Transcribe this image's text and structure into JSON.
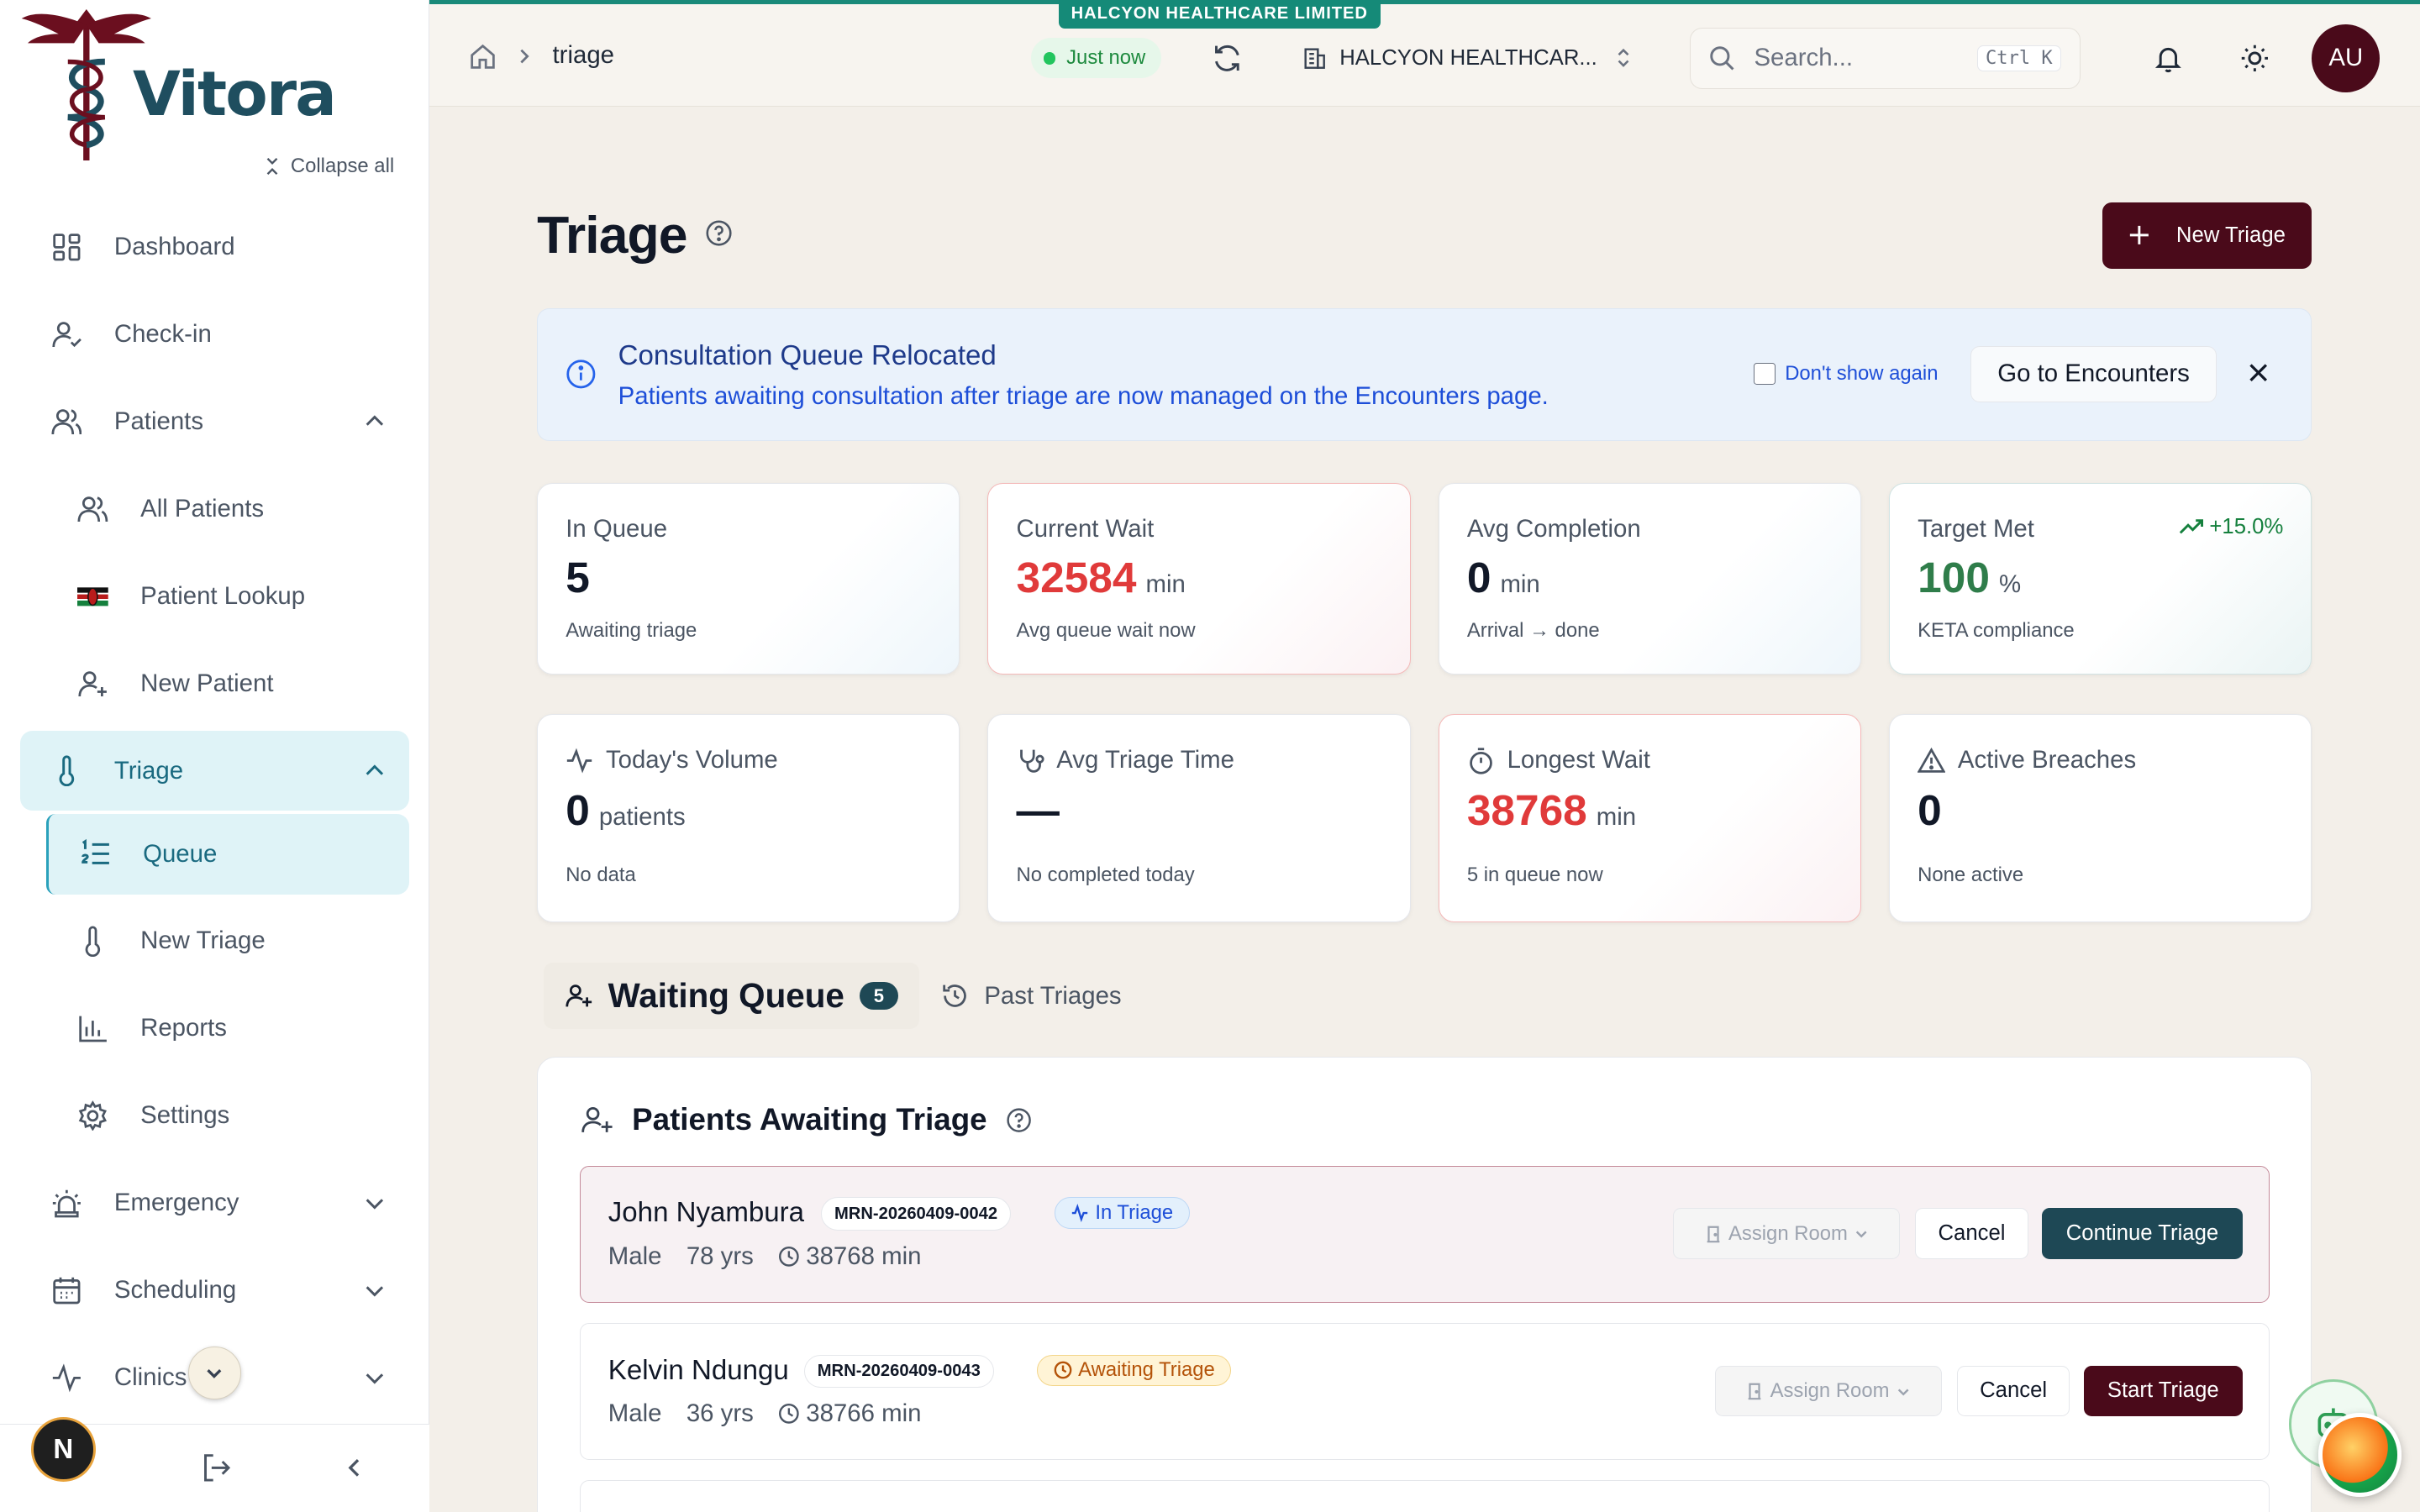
{
  "brand": {
    "name": "Vitora"
  },
  "sidebar": {
    "collapse_label": "Collapse all",
    "items": [
      {
        "label": "Dashboard",
        "icon": "dashboard-icon"
      },
      {
        "label": "Check-in",
        "icon": "user-check-icon"
      },
      {
        "label": "Patients",
        "icon": "users-icon",
        "expanded": true
      },
      {
        "label": "All Patients",
        "icon": "users-icon"
      },
      {
        "label": "Patient Lookup",
        "icon": "kenya-flag-icon"
      },
      {
        "label": "New Patient",
        "icon": "user-plus-icon"
      },
      {
        "label": "Triage",
        "icon": "thermometer-icon",
        "expanded": true,
        "active": true
      },
      {
        "label": "Queue",
        "icon": "list-ordered-icon",
        "active": true
      },
      {
        "label": "New Triage",
        "icon": "thermometer-icon"
      },
      {
        "label": "Reports",
        "icon": "bar-chart-icon"
      },
      {
        "label": "Settings",
        "icon": "gear-icon"
      },
      {
        "label": "Emergency",
        "icon": "siren-icon"
      },
      {
        "label": "Scheduling",
        "icon": "calendar-icon"
      },
      {
        "label": "Clinics",
        "icon": "activity-icon"
      }
    ],
    "footer_avatar": "N"
  },
  "topbar": {
    "tenant_tag": "HALCYON HEALTHCARE LIMITED",
    "breadcrumb": "triage",
    "status": "Just now",
    "tenant_select": "HALCYON HEALTHCAR...",
    "search_placeholder": "Search...",
    "shortcut_ctrl": "Ctrl",
    "shortcut_key": "K",
    "user_initials": "AU"
  },
  "page": {
    "title": "Triage",
    "new_button": "New Triage"
  },
  "banner": {
    "title": "Consultation Queue Relocated",
    "text": "Patients awaiting consultation after triage are now managed on the Encounters page.",
    "dont_show": "Don't show again",
    "action": "Go to Encounters"
  },
  "stats": {
    "in_queue": {
      "label": "In Queue",
      "value": "5",
      "sub": "Awaiting triage"
    },
    "current_wait": {
      "label": "Current Wait",
      "value": "32584",
      "unit": "min",
      "sub": "Avg queue wait now"
    },
    "avg_completion": {
      "label": "Avg Completion",
      "value": "0",
      "unit": "min",
      "sub": "Arrival → done"
    },
    "target_met": {
      "label": "Target Met",
      "value": "100",
      "unit": "%",
      "sub": "KETA compliance",
      "trend": "+15.0%"
    },
    "todays_volume": {
      "label": "Today's Volume",
      "value": "0",
      "unit": "patients",
      "sub": "No data"
    },
    "avg_triage_time": {
      "label": "Avg Triage Time",
      "value": "—",
      "sub": "No completed today"
    },
    "longest_wait": {
      "label": "Longest Wait",
      "value": "38768",
      "unit": "min",
      "sub": "5 in queue now"
    },
    "active_breaches": {
      "label": "Active Breaches",
      "value": "0",
      "sub": "None active"
    }
  },
  "tabs": {
    "waiting": {
      "label": "Waiting Queue",
      "count": "5"
    },
    "past": {
      "label": "Past Triages"
    }
  },
  "queue": {
    "title": "Patients Awaiting Triage",
    "assign_label": "Assign Room",
    "cancel_label": "Cancel",
    "patients": [
      {
        "name": "John Nyambura",
        "mrn": "MRN-20260409-0042",
        "status": "In Triage",
        "sex": "Male",
        "age": "78 yrs",
        "wait": "38768 min",
        "action": "Continue Triage"
      },
      {
        "name": "Kelvin Ndungu",
        "mrn": "MRN-20260409-0043",
        "status": "Awaiting Triage",
        "sex": "Male",
        "age": "36 yrs",
        "wait": "38766 min",
        "action": "Start Triage"
      }
    ]
  }
}
